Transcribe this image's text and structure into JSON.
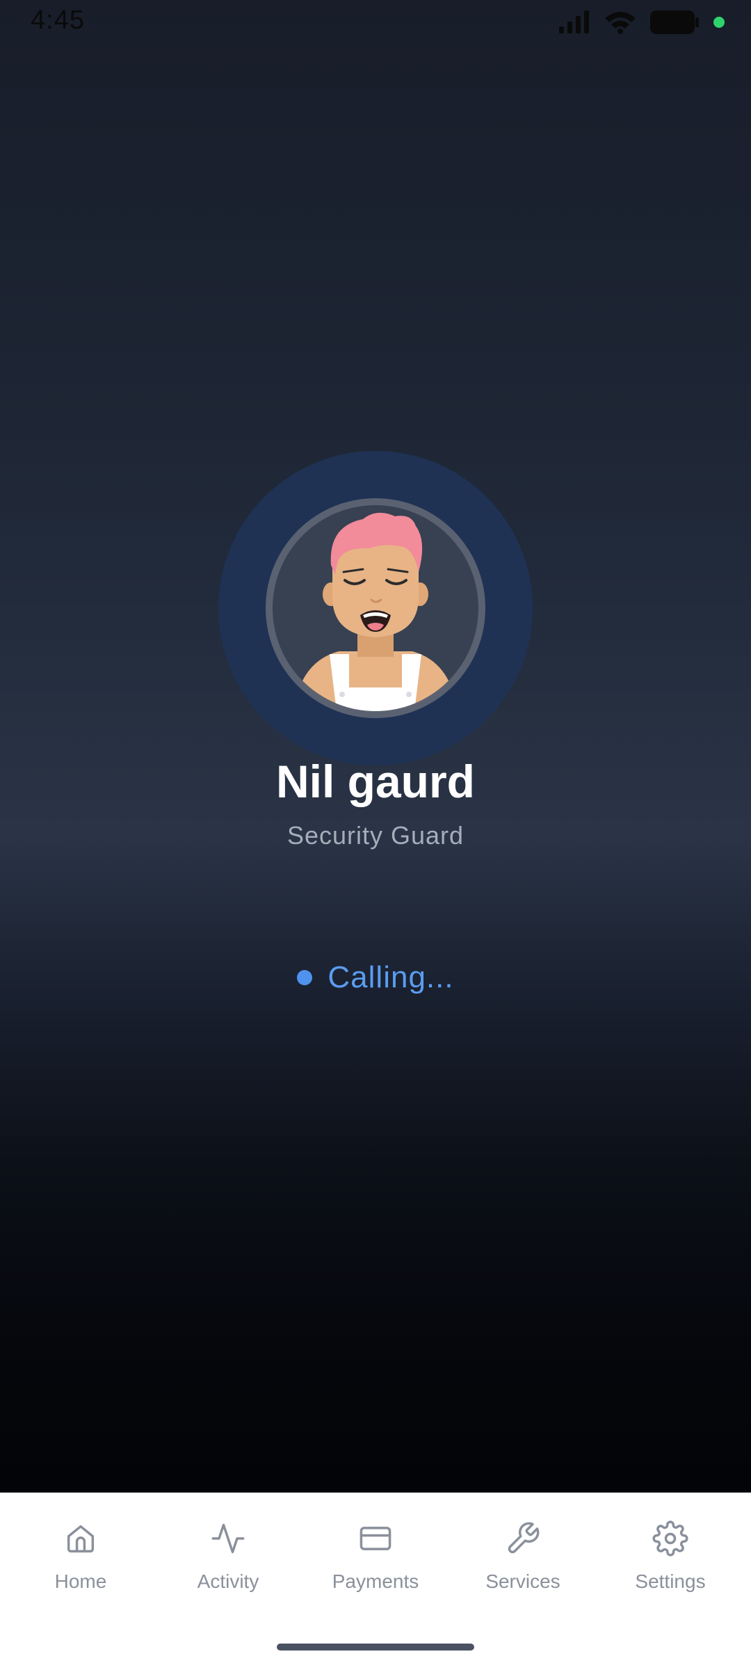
{
  "status_bar": {
    "time": "4:45",
    "icons": [
      "signal-icon",
      "wifi-icon",
      "battery-icon",
      "active-dot-icon"
    ],
    "active_dot_color": "#2fd36b"
  },
  "caller": {
    "name": "Nil gaurd",
    "role": "Security Guard",
    "avatar": "avatar-illustration"
  },
  "call": {
    "status": "Calling...",
    "status_color": "#5b9cf0"
  },
  "bottom_nav": {
    "items": [
      {
        "label": "Home",
        "icon": "home-icon"
      },
      {
        "label": "Activity",
        "icon": "activity-icon"
      },
      {
        "label": "Payments",
        "icon": "credit-card-icon"
      },
      {
        "label": "Services",
        "icon": "wrench-icon"
      },
      {
        "label": "Settings",
        "icon": "gear-icon"
      }
    ]
  }
}
